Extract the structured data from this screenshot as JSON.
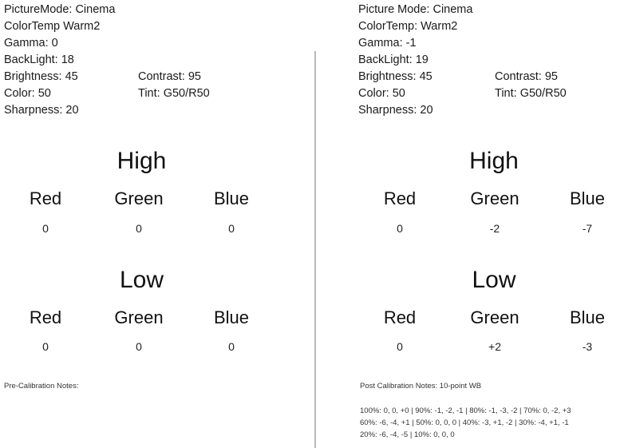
{
  "before": {
    "settings": {
      "picture_mode": "PictureMode: Cinema",
      "color_temp": "ColorTemp  Warm2",
      "gamma": "Gamma: 0",
      "backlight": "BackLight: 18",
      "brightness": "Brightness: 45",
      "contrast": "Contrast: 95",
      "color": "Color: 50",
      "tint": "Tint: G50/R50",
      "sharpness": "Sharpness: 20"
    },
    "high": {
      "title": "High",
      "channels": [
        {
          "label": "Red",
          "value": "0"
        },
        {
          "label": "Green",
          "value": "0"
        },
        {
          "label": "Blue",
          "value": "0"
        }
      ]
    },
    "low": {
      "title": "Low",
      "channels": [
        {
          "label": "Red",
          "value": "0"
        },
        {
          "label": "Green",
          "value": "0"
        },
        {
          "label": "Blue",
          "value": "0"
        }
      ]
    },
    "notes": {
      "title": "Pre-Calibration Notes:",
      "lines": []
    }
  },
  "after": {
    "settings": {
      "picture_mode": "Picture Mode: Cinema",
      "color_temp": "ColorTemp: Warm2",
      "gamma": "Gamma: -1",
      "backlight": "BackLight: 19",
      "brightness": "Brightness: 45",
      "contrast": "Contrast: 95",
      "color": "Color: 50",
      "tint": "Tint: G50/R50",
      "sharpness": "Sharpness: 20"
    },
    "high": {
      "title": "High",
      "channels": [
        {
          "label": "Red",
          "value": "0"
        },
        {
          "label": "Green",
          "value": "-2"
        },
        {
          "label": "Blue",
          "value": "-7"
        }
      ]
    },
    "low": {
      "title": "Low",
      "channels": [
        {
          "label": "Red",
          "value": "0"
        },
        {
          "label": "Green",
          "value": "+2"
        },
        {
          "label": "Blue",
          "value": "-3"
        }
      ]
    },
    "notes": {
      "title": "Post Calibration Notes: 10-point WB",
      "lines": [
        "100%: 0, 0, +0 | 90%: -1, -2, -1 | 80%: -1, -3, -2 | 70%: 0, -2, +3",
        "60%: -6, -4, +1 | 50%: 0, 0, 0 | 40%: -3, +1, -2 | 30%: -4, +1, -1",
        "20%: -6, -4, -5 | 10%: 0, 0, 0"
      ]
    }
  }
}
